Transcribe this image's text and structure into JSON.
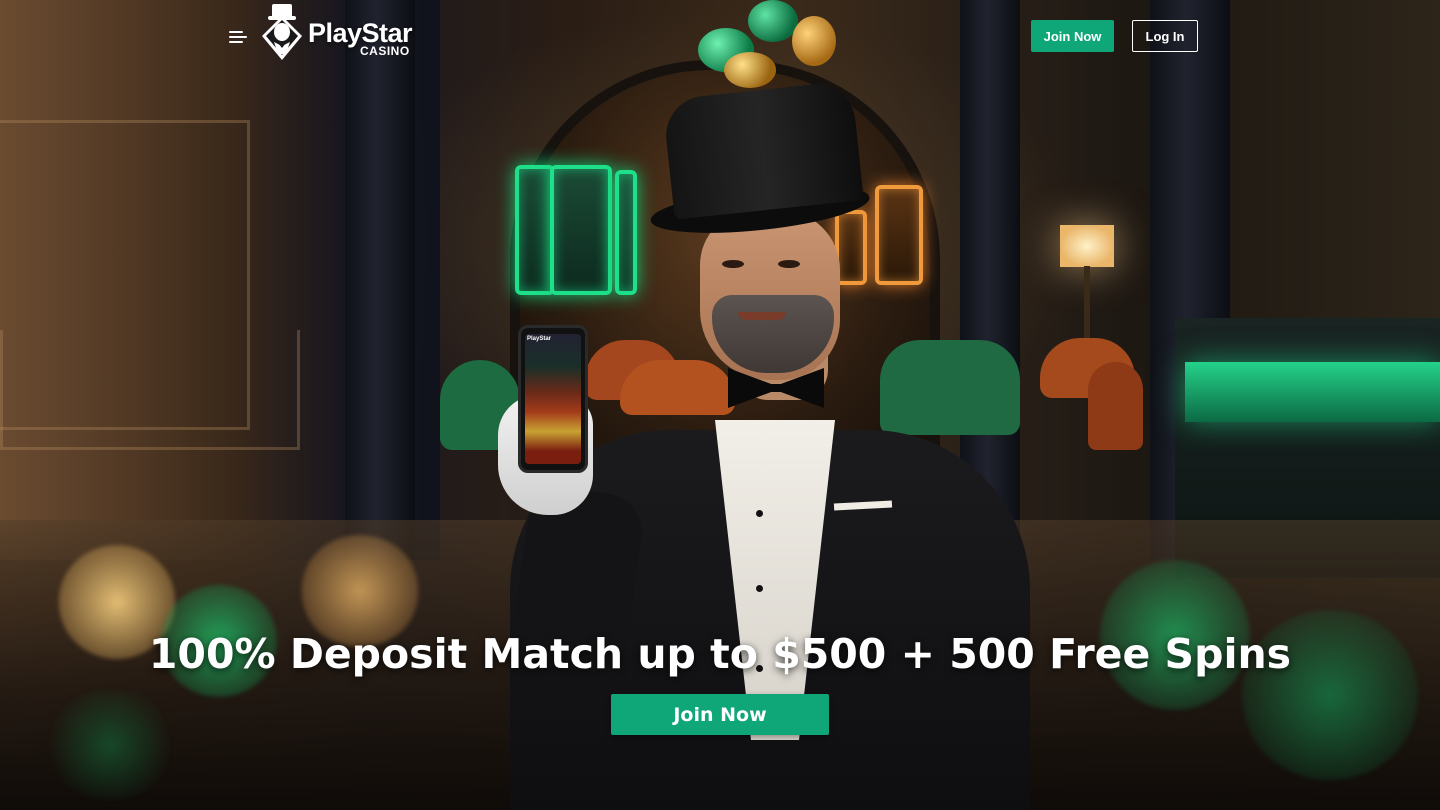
{
  "header": {
    "menu_icon": "hamburger-menu-icon",
    "logo": {
      "name": "PlayStar",
      "sub": "CASINO",
      "mark_icon": "top-hat-gentleman-icon"
    },
    "join_label": "Join Now",
    "login_label": "Log In"
  },
  "hero": {
    "headline": "100% Deposit Match up to $500 + 500 Free Spins",
    "cta_label": "Join Now",
    "phone_brand": "PlayStar"
  },
  "colors": {
    "accent_green": "#0fa678",
    "text_white": "#ffffff"
  }
}
